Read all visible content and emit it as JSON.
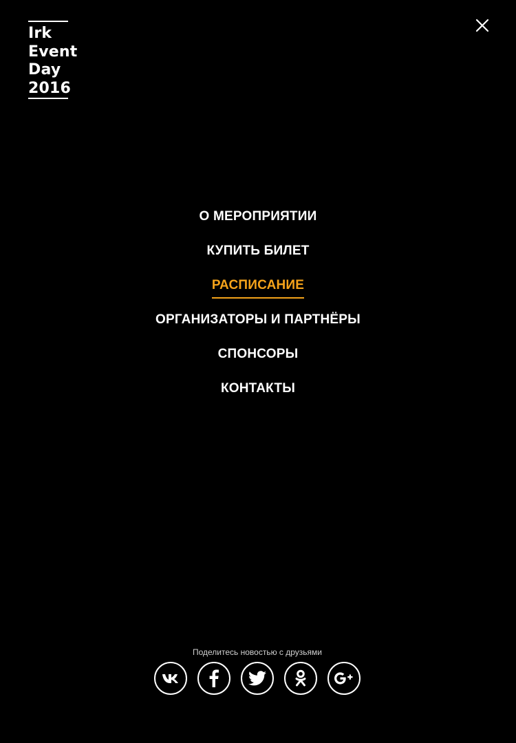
{
  "logo": {
    "line1": "Irk",
    "line2": "Event",
    "line3": "Day",
    "line4": "2016"
  },
  "header": {
    "close_icon": "close-icon"
  },
  "menu": {
    "items": [
      {
        "label": "О МЕРОПРИЯТИИ",
        "active": false
      },
      {
        "label": "КУПИТЬ БИЛЕТ",
        "active": false
      },
      {
        "label": "РАСПИСАНИЕ",
        "active": true
      },
      {
        "label": "ОРГАНИЗАТОРЫ И ПАРТНЁРЫ",
        "active": false
      },
      {
        "label": "СПОНСОРЫ",
        "active": false
      },
      {
        "label": "КОНТАКТЫ",
        "active": false
      }
    ]
  },
  "share": {
    "title": "Поделитесь новостью с друзьями",
    "icons": [
      "vk-icon",
      "facebook-icon",
      "twitter-icon",
      "odnoklassniki-icon",
      "google-plus-icon"
    ]
  },
  "colors": {
    "background": "#000000",
    "text": "#ffffff",
    "accent": "#f5a31a"
  }
}
